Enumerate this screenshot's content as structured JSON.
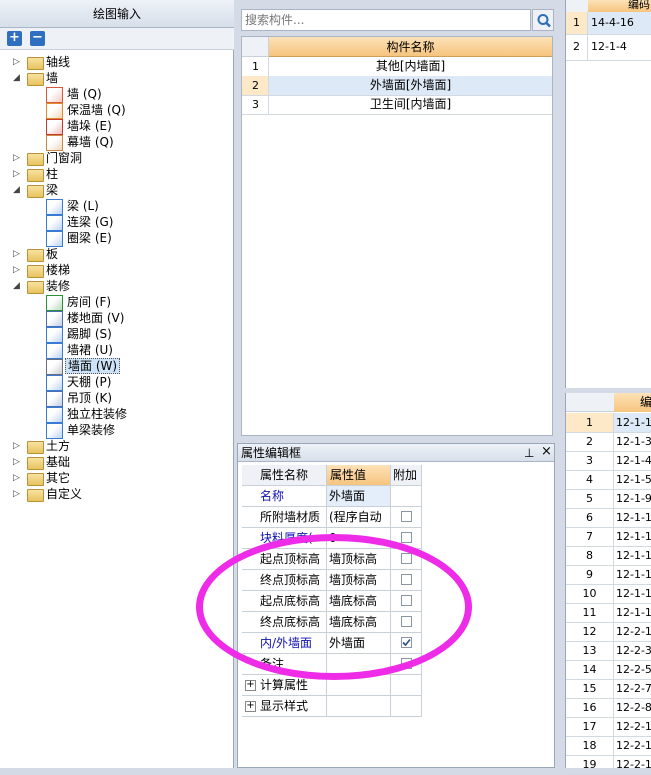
{
  "left_panel": {
    "title": "绘图输入",
    "tree": [
      {
        "label": "轴线",
        "level": 0,
        "expanded": false
      },
      {
        "label": "墙",
        "level": 0,
        "expanded": true
      },
      {
        "label": "墙 (Q)",
        "level": 1
      },
      {
        "label": "保温墙 (Q)",
        "level": 1
      },
      {
        "label": "墙垛 (E)",
        "level": 1
      },
      {
        "label": "幕墙 (Q)",
        "level": 1
      },
      {
        "label": "门窗洞",
        "level": 0,
        "expanded": false
      },
      {
        "label": "柱",
        "level": 0,
        "expanded": false
      },
      {
        "label": "梁",
        "level": 0,
        "expanded": true
      },
      {
        "label": "梁 (L)",
        "level": 1
      },
      {
        "label": "连梁 (G)",
        "level": 1
      },
      {
        "label": "圈梁 (E)",
        "level": 1
      },
      {
        "label": "板",
        "level": 0,
        "expanded": false
      },
      {
        "label": "楼梯",
        "level": 0,
        "expanded": false
      },
      {
        "label": "装修",
        "level": 0,
        "expanded": true
      },
      {
        "label": "房间 (F)",
        "level": 1
      },
      {
        "label": "楼地面 (V)",
        "level": 1
      },
      {
        "label": "踢脚 (S)",
        "level": 1
      },
      {
        "label": "墙裙 (U)",
        "level": 1
      },
      {
        "label": "墙面 (W)",
        "level": 1,
        "selected": true
      },
      {
        "label": "天棚 (P)",
        "level": 1
      },
      {
        "label": "吊顶 (K)",
        "level": 1
      },
      {
        "label": "独立柱装修",
        "level": 1
      },
      {
        "label": "单梁装修",
        "level": 1
      },
      {
        "label": "土方",
        "level": 0,
        "expanded": false
      },
      {
        "label": "基础",
        "level": 0,
        "expanded": false
      },
      {
        "label": "其它",
        "level": 0,
        "expanded": false
      },
      {
        "label": "自定义",
        "level": 0,
        "expanded": false
      }
    ]
  },
  "search": {
    "placeholder": "搜索构件..."
  },
  "component_list": {
    "header": "构件名称",
    "rows": [
      {
        "num": "1",
        "name": "其他[内墙面]"
      },
      {
        "num": "2",
        "name": "外墙面[外墙面]",
        "selected": true
      },
      {
        "num": "3",
        "name": "卫生间[内墙面]"
      }
    ]
  },
  "property_panel": {
    "title": "属性编辑框",
    "pin": "ᵖ",
    "close": "×",
    "headers": [
      "属性名称",
      "属性值",
      "附加"
    ],
    "rows": [
      {
        "name": "名称",
        "value": "外墙面",
        "blue": true,
        "checkbox": false
      },
      {
        "name": "所附墙材质",
        "value": "(程序自动",
        "blue": false,
        "checkbox": true,
        "checked": false
      },
      {
        "name": "块料厚度(",
        "value": "0",
        "blue": true,
        "checkbox": true,
        "checked": false
      },
      {
        "name": "起点顶标高",
        "value": "墙顶标高",
        "blue": false,
        "checkbox": true,
        "checked": false
      },
      {
        "name": "终点顶标高",
        "value": "墙顶标高",
        "blue": false,
        "checkbox": true,
        "checked": false
      },
      {
        "name": "起点底标高",
        "value": "墙底标高",
        "blue": false,
        "checkbox": true,
        "checked": false
      },
      {
        "name": "终点底标高",
        "value": "墙底标高",
        "blue": false,
        "checkbox": true,
        "checked": false
      },
      {
        "name": "内/外墙面",
        "value": "外墙面",
        "blue": true,
        "checkbox": true,
        "checked": true
      },
      {
        "name": "备注",
        "value": "",
        "blue": false,
        "checkbox": true,
        "checked": false
      },
      {
        "name": "计算属性",
        "value": "",
        "blue": false,
        "expander": "+"
      },
      {
        "name": "显示样式",
        "value": "",
        "blue": false,
        "expander": "+"
      }
    ]
  },
  "right_top_table": {
    "header": "编码",
    "rows": [
      {
        "num": "1",
        "code": "14-4-16",
        "selected": true
      },
      {
        "num": "2",
        "code": "12-1-4"
      }
    ]
  },
  "right_bottom_table": {
    "header": "编",
    "rows": [
      {
        "num": "1",
        "code": "12-1-1",
        "selected": true
      },
      {
        "num": "2",
        "code": "12-1-3"
      },
      {
        "num": "3",
        "code": "12-1-4"
      },
      {
        "num": "4",
        "code": "12-1-5"
      },
      {
        "num": "5",
        "code": "12-1-9"
      },
      {
        "num": "6",
        "code": "12-1-1"
      },
      {
        "num": "7",
        "code": "12-1-1"
      },
      {
        "num": "8",
        "code": "12-1-1"
      },
      {
        "num": "9",
        "code": "12-1-1"
      },
      {
        "num": "10",
        "code": "12-1-1"
      },
      {
        "num": "11",
        "code": "12-1-1"
      },
      {
        "num": "12",
        "code": "12-2-1"
      },
      {
        "num": "13",
        "code": "12-2-3"
      },
      {
        "num": "14",
        "code": "12-2-5"
      },
      {
        "num": "15",
        "code": "12-2-7"
      },
      {
        "num": "16",
        "code": "12-2-8"
      },
      {
        "num": "17",
        "code": "12-2-1"
      },
      {
        "num": "18",
        "code": "12-2-1"
      },
      {
        "num": "19",
        "code": "12-2-1"
      }
    ]
  },
  "colors": {
    "annotation": "#ee2ce8",
    "selection": "#cde3f7",
    "header": "#f6c47e",
    "blue_text": "#1010b0"
  }
}
